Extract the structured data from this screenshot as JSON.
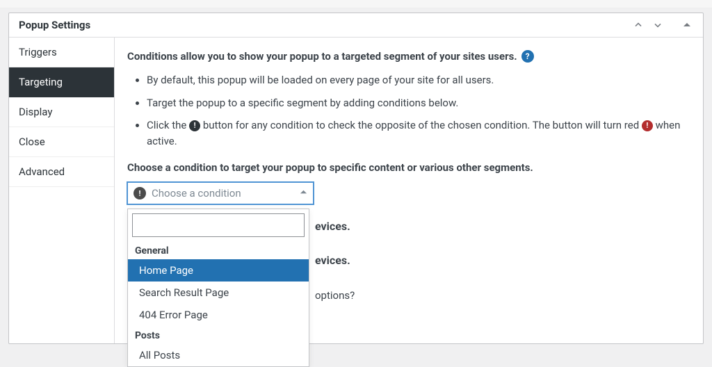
{
  "panel": {
    "title": "Popup Settings"
  },
  "tabs": {
    "items": [
      {
        "label": "Triggers"
      },
      {
        "label": "Targeting"
      },
      {
        "label": "Display"
      },
      {
        "label": "Close"
      },
      {
        "label": "Advanced"
      }
    ],
    "activeIndex": 1
  },
  "content": {
    "intro": "Conditions allow you to show your popup to a targeted segment of your sites users.",
    "bullets": {
      "b1": "By default, this popup will be loaded on every page of your site for all users.",
      "b2": "Target the popup to a specific segment by adding conditions below.",
      "b3_pre": "Click the ",
      "b3_mid": " button for any condition to check the opposite of the chosen condition. The button will turn red ",
      "b3_post": " when active."
    },
    "choose_heading": "Choose a condition to target your popup to specific content or various other segments.",
    "select_placeholder": "Choose a condition",
    "dropdown": {
      "search_value": "",
      "groups": [
        {
          "label": "General",
          "options": [
            {
              "label": "Home Page",
              "selected": true
            },
            {
              "label": "Search Result Page",
              "selected": false
            },
            {
              "label": "404 Error Page",
              "selected": false
            }
          ]
        },
        {
          "label": "Posts",
          "options": [
            {
              "label": "All Posts",
              "selected": false
            }
          ]
        }
      ]
    },
    "behind_text_1": "evices.",
    "behind_text_2": "evices.",
    "behind_text_3": "options?"
  }
}
